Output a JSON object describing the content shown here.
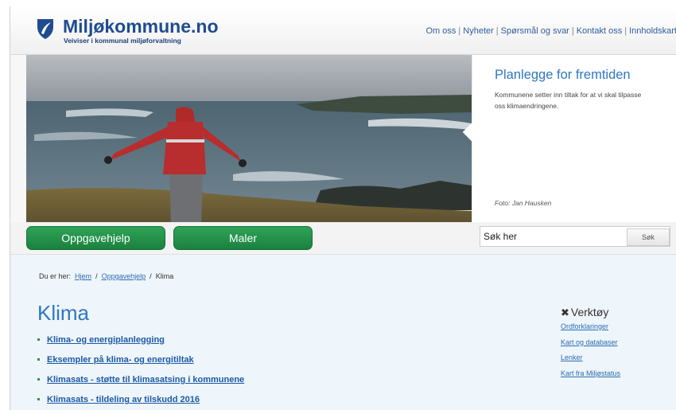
{
  "header": {
    "brand": "Miljøkommune.no",
    "tagline": "Veiviser i kommunal miljøforvaltning",
    "nav": [
      "Om oss",
      "Nyheter",
      "Spørsmål og svar",
      "Kontakt oss",
      "Innholdskart"
    ]
  },
  "hero": {
    "title": "Planlegge for fremtiden",
    "text": "Kommunene setter inn tiltak for at vi skal tilpasse oss klimaendringene.",
    "photo_credit": "Foto: Jan Hausken"
  },
  "navbar": {
    "btn1": "Oppgavehjelp",
    "btn2": "Maler",
    "search_value": "Søk her",
    "search_button": "Søk"
  },
  "breadcrumb": {
    "prefix": "Du er her:",
    "items": [
      "Hjem",
      "Oppgavehjelp",
      "Klima"
    ]
  },
  "main": {
    "title": "Klima",
    "links": [
      "Klima- og energiplanlegging",
      "Eksempler på klima- og energitiltak",
      "Klimasats - støtte til klimasatsing i kommunene",
      "Klimasats - tildeling av tilskudd 2016"
    ]
  },
  "tools": {
    "title": "Verktøy",
    "links": [
      "Ordforklaringer",
      "Kart og databaser",
      "Lenker",
      "Kart fra Miljøstatus"
    ]
  },
  "colors": {
    "brand_blue": "#1e4c8f",
    "accent_green": "#1b8140",
    "link_blue": "#2d6db1"
  }
}
